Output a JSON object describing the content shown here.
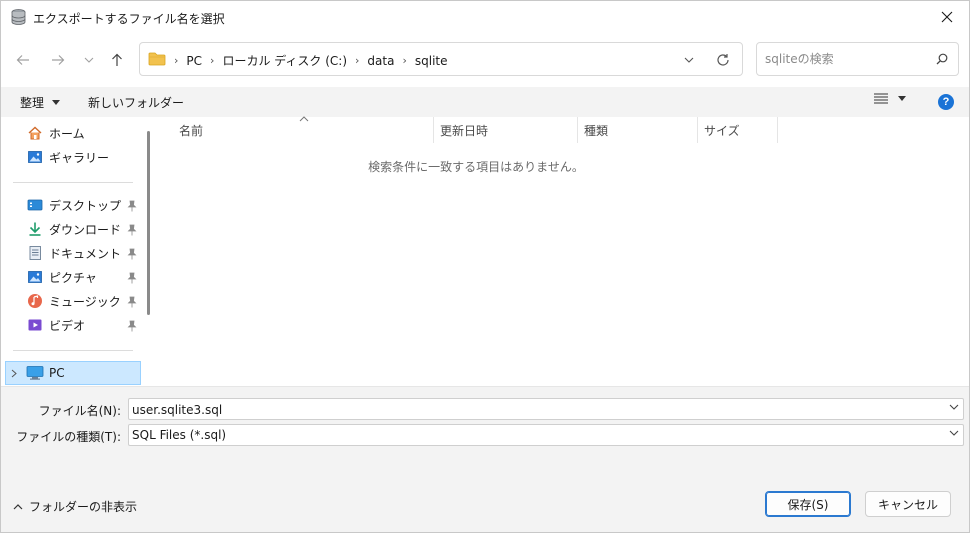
{
  "window": {
    "title": "エクスポートするファイル名を選択"
  },
  "address": {
    "crumbs": [
      "PC",
      "ローカル ディスク (C:)",
      "data",
      "sqlite"
    ]
  },
  "search": {
    "placeholder": "sqliteの検索"
  },
  "commands": {
    "organize": "整理",
    "new_folder": "新しいフォルダー"
  },
  "sidebar": {
    "items": [
      {
        "label": "ホーム",
        "icon": "home-icon"
      },
      {
        "label": "ギャラリー",
        "icon": "gallery-icon"
      },
      {
        "label": "デスクトップ",
        "icon": "desktop-icon",
        "pinned": true
      },
      {
        "label": "ダウンロード",
        "icon": "download-icon",
        "pinned": true
      },
      {
        "label": "ドキュメント",
        "icon": "document-icon",
        "pinned": true
      },
      {
        "label": "ピクチャ",
        "icon": "pictures-icon",
        "pinned": true
      },
      {
        "label": "ミュージック",
        "icon": "music-icon",
        "pinned": true
      },
      {
        "label": "ビデオ",
        "icon": "video-icon",
        "pinned": true
      }
    ],
    "pc": {
      "label": "PC",
      "icon": "pc-icon",
      "selected": true
    }
  },
  "file_list": {
    "columns": [
      "名前",
      "更新日時",
      "種類",
      "サイズ"
    ],
    "empty_message": "検索条件に一致する項目はありません。"
  },
  "form": {
    "filename_label": "ファイル名(N):",
    "filename_value": "user.sqlite3.sql",
    "filetype_label": "ファイルの種類(T):",
    "filetype_value": "SQL Files (*.sql)"
  },
  "footer": {
    "toggle_folders": "フォルダーの非表示",
    "save": "保存(S)",
    "cancel": "キャンセル"
  },
  "colors": {
    "accent": "#1a73d6",
    "selection_bg": "#cce8ff",
    "panel_bg": "#f3f3f3"
  }
}
